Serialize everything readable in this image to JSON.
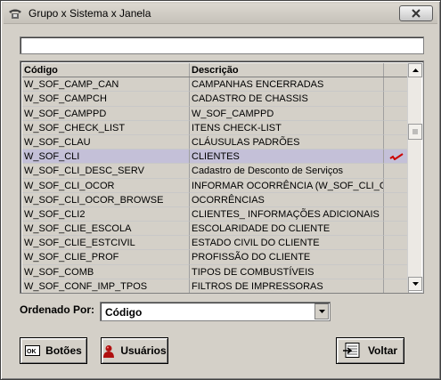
{
  "window": {
    "title": "Grupo x Sistema x Janela"
  },
  "search": {
    "value": ""
  },
  "grid": {
    "columns": [
      "Código",
      "Descrição"
    ],
    "rows": [
      {
        "code": "W_SOF_CAMP_CAN",
        "desc": "CAMPANHAS ENCERRADAS",
        "flag": false
      },
      {
        "code": "W_SOF_CAMPCH",
        "desc": "CADASTRO DE CHASSIS",
        "flag": false
      },
      {
        "code": "W_SOF_CAMPPD",
        "desc": "W_SOF_CAMPPD",
        "flag": false
      },
      {
        "code": "W_SOF_CHECK_LIST",
        "desc": "ITENS CHECK-LIST",
        "flag": false
      },
      {
        "code": "W_SOF_CLAU",
        "desc": "CLÁUSULAS PADRÕES",
        "flag": false
      },
      {
        "code": "W_SOF_CLI",
        "desc": "CLIENTES",
        "flag": true
      },
      {
        "code": "W_SOF_CLI_DESC_SERV",
        "desc": "Cadastro de Desconto de Serviços",
        "flag": false
      },
      {
        "code": "W_SOF_CLI_OCOR",
        "desc": "INFORMAR OCORRÊNCIA (W_SOF_CLI_OCO",
        "flag": false
      },
      {
        "code": "W_SOF_CLI_OCOR_BROWSE",
        "desc": "OCORRÊNCIAS",
        "flag": false
      },
      {
        "code": "W_SOF_CLI2",
        "desc": "CLIENTES_ INFORMAÇÕES ADICIONAIS",
        "flag": false
      },
      {
        "code": "W_SOF_CLIE_ESCOLA",
        "desc": "ESCOLARIDADE DO CLIENTE",
        "flag": false
      },
      {
        "code": "W_SOF_CLIE_ESTCIVIL",
        "desc": "ESTADO CIVIL DO CLIENTE",
        "flag": false
      },
      {
        "code": "W_SOF_CLIE_PROF",
        "desc": "PROFISSÃO DO CLIENTE",
        "flag": false
      },
      {
        "code": "W_SOF_COMB",
        "desc": "TIPOS DE COMBUSTÍVEIS",
        "flag": false
      },
      {
        "code": "W_SOF_CONF_IMP_TPOS",
        "desc": "FILTROS DE IMPRESSORAS",
        "flag": false
      }
    ],
    "selected_index": 5
  },
  "order": {
    "label": "Ordenado Por:",
    "value": "Código"
  },
  "buttons": {
    "botoes": "Botões",
    "usuarios": "Usuários",
    "voltar": "Voltar"
  },
  "icons": {
    "title": "phone-icon",
    "flag": "check-mark-icon"
  },
  "colors": {
    "selected_row": "#c4c0d8",
    "flag": "#cc0000"
  }
}
